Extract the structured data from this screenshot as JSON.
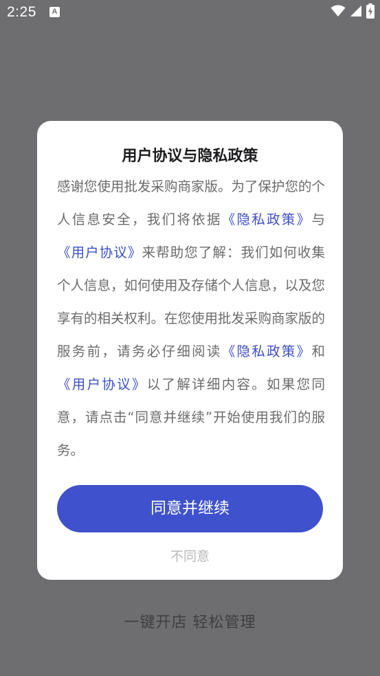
{
  "status_bar": {
    "time": "2:25",
    "notification_glyph": "A",
    "icons": [
      "wifi-icon",
      "cellular-signal-icon",
      "battery-charging-icon"
    ],
    "icon_color": "#ffffff"
  },
  "background": {
    "tagline": "一键开店  轻松管理",
    "scrim_color": "#6e6d70"
  },
  "dialog": {
    "title": "用户协议与隐私政策",
    "body": {
      "t1": "感谢您使用批发采购商家版。为了保护您的个人信息安全，我们将依据",
      "link_privacy_1": "《隐私政策》",
      "t2": "与",
      "link_user_1": "《用户协议》",
      "t3": "来帮助您了解：我们如何收集个人信息，如何使用及存储个人信息，以及您享有的相关权利。在您使用批发采购商家版的服务前，请务必仔细阅读",
      "link_privacy_2": "《隐私政策》",
      "t4": "和",
      "link_user_2": "《用户协议》",
      "t5": "以了解详细内容。如果您同意，请点击“同意并继续”开始使用我们的服务。"
    },
    "agree_label": "同意并继续",
    "disagree_label": "不同意",
    "accent_color": "#3f51cc",
    "link_color": "#3d4fc6"
  }
}
